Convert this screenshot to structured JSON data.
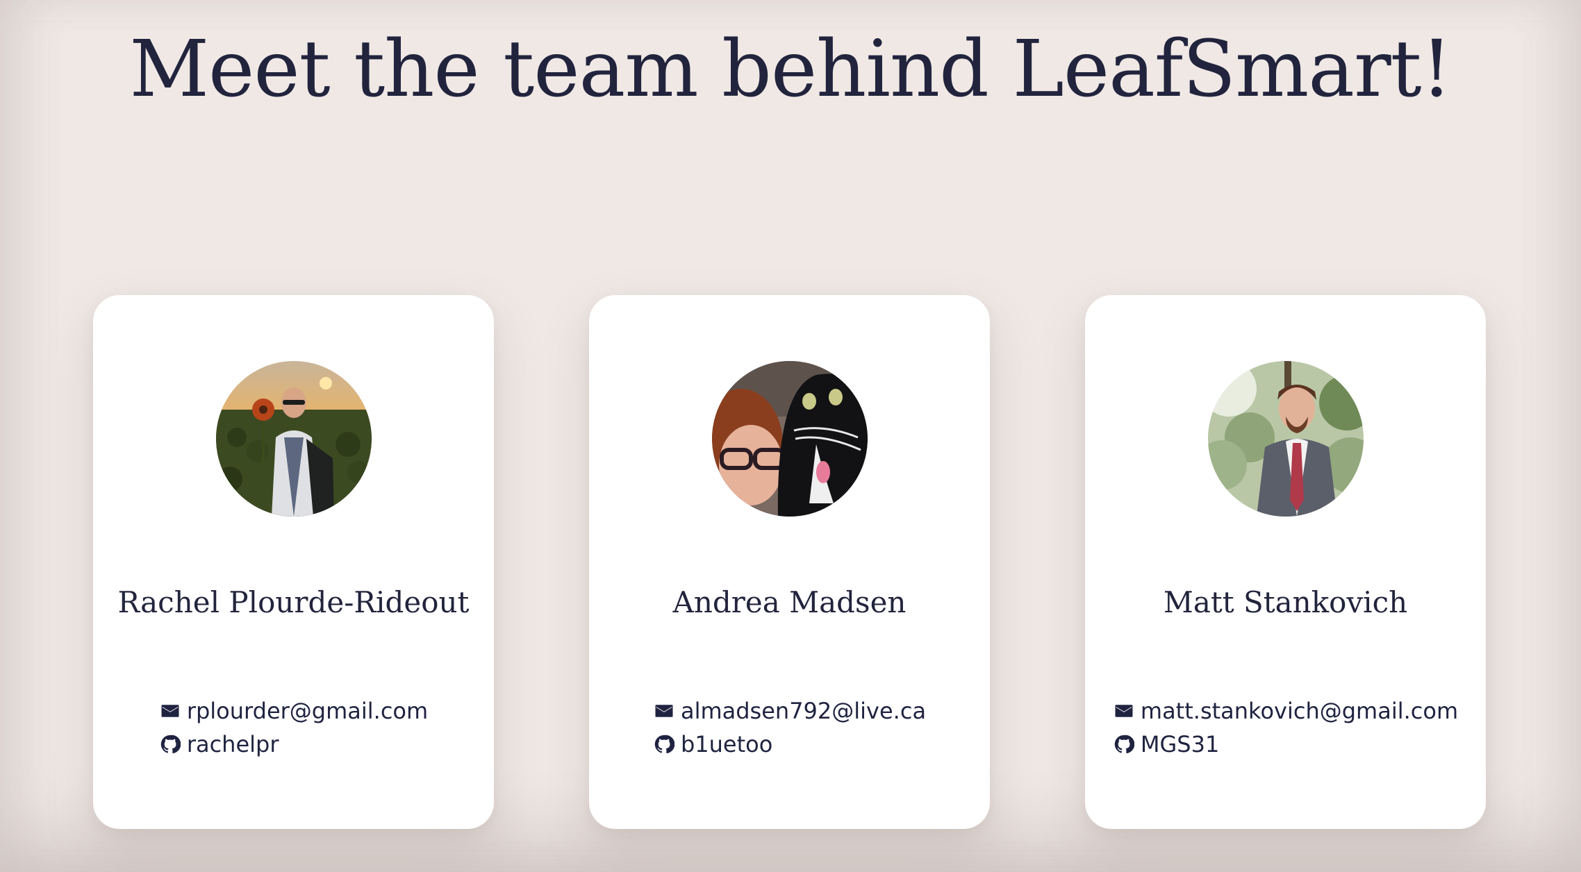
{
  "page": {
    "title": "Meet the team behind LeafSmart!"
  },
  "team": [
    {
      "name": "Rachel Plourde-Rideout",
      "email": "rplourder@gmail.com",
      "github": "rachelpr",
      "email_icon": "email-icon",
      "github_icon": "github-icon"
    },
    {
      "name": "Andrea Madsen",
      "email": "almadsen792@live.ca",
      "github": "b1uetoo",
      "email_icon": "email-icon",
      "github_icon": "github-icon"
    },
    {
      "name": "Matt Stankovich",
      "email": "matt.stankovich@gmail.com",
      "github": "MGS31",
      "email_icon": "email-icon",
      "github_icon": "github-icon"
    }
  ],
  "colors": {
    "background": "#efe8e5",
    "card": "#ffffff",
    "text": "#22243d"
  }
}
